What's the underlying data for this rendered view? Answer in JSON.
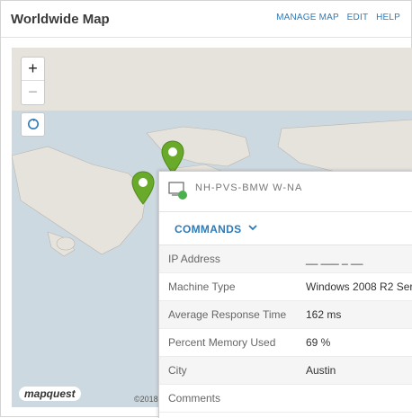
{
  "header": {
    "title": "Worldwide Map",
    "links": [
      "MANAGE MAP",
      "EDIT",
      "HELP"
    ]
  },
  "map": {
    "zoom_in": "+",
    "zoom_out": "−",
    "attribution_logo": "mapquest",
    "copyright": "©2018"
  },
  "popup": {
    "node_name": "NH-PVS-BMW W-NA",
    "commands_label": "COMMANDS",
    "details": [
      {
        "label": "IP Address",
        "value": "__ ___ _ __"
      },
      {
        "label": "Machine Type",
        "value": "Windows 2008 R2 Ser"
      },
      {
        "label": "Average Response Time",
        "value": "162 ms"
      },
      {
        "label": "Percent Memory Used",
        "value": "69 %"
      },
      {
        "label": "City",
        "value": "Austin"
      },
      {
        "label": "Comments",
        "value": ""
      }
    ]
  },
  "colors": {
    "link": "#2d7bb8",
    "pin": "#6aaa2a",
    "status": "#4caf50"
  }
}
